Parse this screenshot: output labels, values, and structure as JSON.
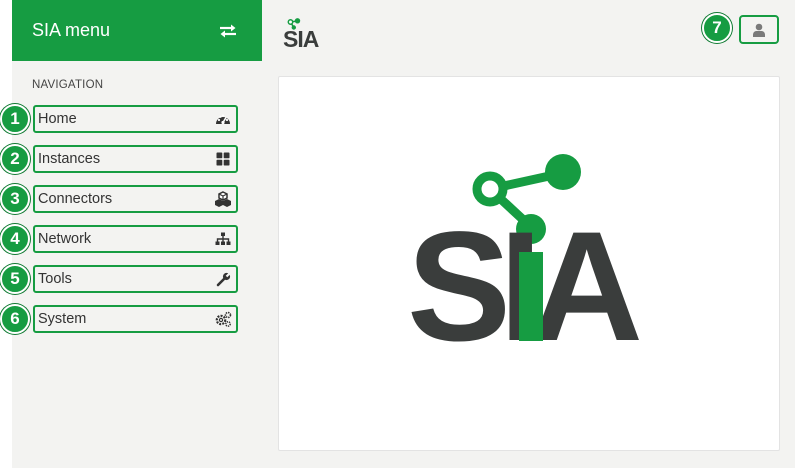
{
  "sidebar": {
    "title": "SIA menu",
    "toggle_icon": "swap-arrows-icon",
    "nav_heading": "NAVIGATION",
    "items": [
      {
        "label": "Home",
        "icon": "dashboard-gauge-icon",
        "badge": "1"
      },
      {
        "label": "Instances",
        "icon": "grid-icon",
        "badge": "2"
      },
      {
        "label": "Connectors",
        "icon": "cubes-icon",
        "badge": "3"
      },
      {
        "label": "Network",
        "icon": "sitemap-icon",
        "badge": "4"
      },
      {
        "label": "Tools",
        "icon": "wrench-icon",
        "badge": "5"
      },
      {
        "label": "System",
        "icon": "gears-icon",
        "badge": "6"
      }
    ]
  },
  "header": {
    "logo_text": "SIA",
    "user_button_badge": "7",
    "user_icon": "user-icon"
  },
  "main": {
    "logo_text": "SIA"
  },
  "colors": {
    "brand_green": "#169c42",
    "logo_dark": "#3a3d3c",
    "background": "#f3f3f1"
  }
}
